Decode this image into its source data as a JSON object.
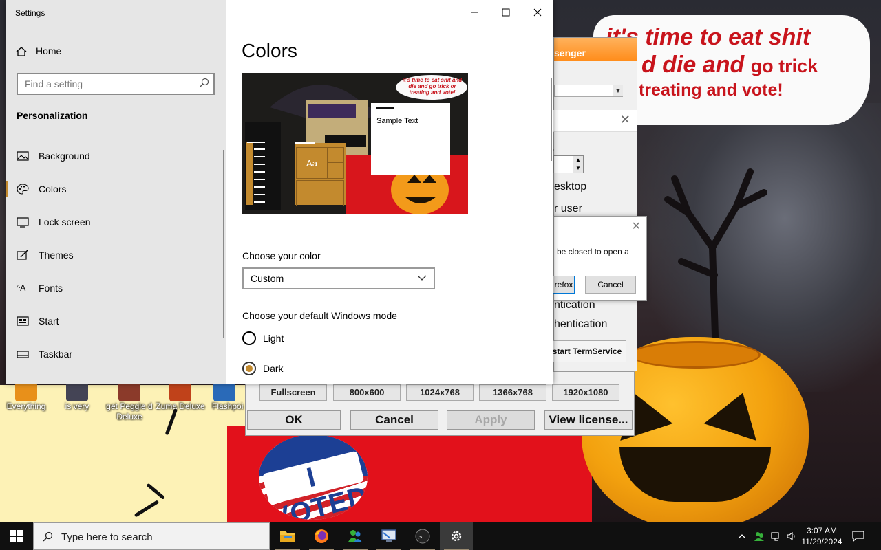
{
  "desktop": {
    "speech_bubble": {
      "line1": "it's time to eat shit",
      "line2a": "d die and",
      "line2b": "go trick",
      "line3": "treating and vote!"
    },
    "sticker_text": "I VOTED",
    "icons": [
      {
        "label": "Everything",
        "icon": "everything-search-icon"
      },
      {
        "label": "is very",
        "icon": "shortcut-icon"
      },
      {
        "label": "get Peggle d Deluxe",
        "icon": "peggle-icon"
      },
      {
        "label": "Zuma Deluxe",
        "icon": "zuma-icon"
      },
      {
        "label": "Flashpoi",
        "icon": "flashpoint-icon"
      }
    ]
  },
  "background_windows": {
    "messenger_title": "senger",
    "labels": [
      "esktop",
      "r user",
      "ntication",
      "hentication"
    ],
    "popup_message": "be closed to open a",
    "popup_button1": "refox",
    "popup_button2": "Cancel",
    "term_button": "start TermService",
    "resolutions": [
      "Fullscreen",
      "800x600",
      "1024x768",
      "1366x768",
      "1920x1080"
    ],
    "dialog_buttons": {
      "ok": "OK",
      "cancel": "Cancel",
      "apply": "Apply",
      "license": "View license..."
    }
  },
  "settings": {
    "app_title": "Settings",
    "home_label": "Home",
    "search_placeholder": "Find a setting",
    "section_title": "Personalization",
    "nav": [
      {
        "label": "Background",
        "icon": "background-image-icon",
        "selected": false
      },
      {
        "label": "Colors",
        "icon": "palette-icon",
        "selected": true
      },
      {
        "label": "Lock screen",
        "icon": "lock-screen-icon",
        "selected": false
      },
      {
        "label": "Themes",
        "icon": "themes-icon",
        "selected": false
      },
      {
        "label": "Fonts",
        "icon": "fonts-icon",
        "selected": false
      },
      {
        "label": "Start",
        "icon": "start-menu-icon",
        "selected": false
      },
      {
        "label": "Taskbar",
        "icon": "taskbar-icon",
        "selected": false
      }
    ],
    "page_title": "Colors",
    "preview": {
      "bubble": "it's time to eat shit and die and go trick or treating and vote!",
      "sample_text": "Sample Text",
      "tile_text": "Aa"
    },
    "choose_color_label": "Choose your color",
    "choose_color_value": "Custom",
    "mode_label": "Choose your default Windows mode",
    "mode_options": [
      {
        "label": "Light",
        "checked": false
      },
      {
        "label": "Dark",
        "checked": true
      }
    ],
    "accent_color": "#c38a2e"
  },
  "taskbar": {
    "search_placeholder": "Type here to search",
    "apps": [
      {
        "name": "file-explorer-icon",
        "running": true
      },
      {
        "name": "firefox-icon",
        "running": true
      },
      {
        "name": "messenger-icon",
        "running": true
      },
      {
        "name": "remote-desktop-icon",
        "running": true
      },
      {
        "name": "terminal-app-icon",
        "running": true
      },
      {
        "name": "settings-gear-icon",
        "running": true,
        "active": true
      }
    ],
    "time": "3:07 AM",
    "date": "11/29/2024"
  }
}
